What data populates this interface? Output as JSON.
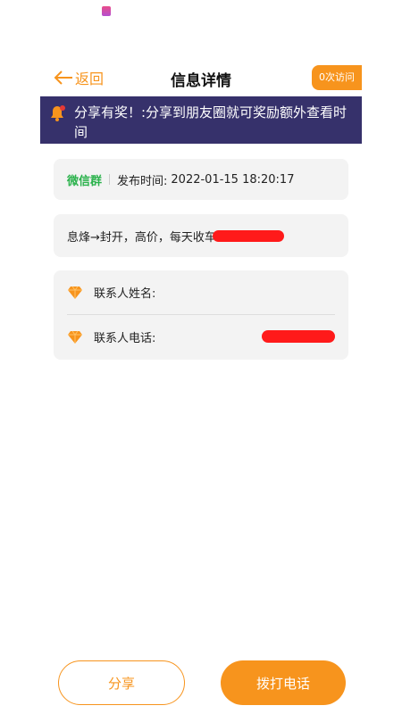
{
  "header": {
    "back_label": "返回",
    "title": "信息详情",
    "visits": "0次访问"
  },
  "banner": {
    "text": "分享有奖！:分享到朋友圈就可奖励额外查看时间"
  },
  "post": {
    "source_tag": "微信群",
    "publish_label": "发布时间:",
    "publish_time": "2022-01-15 18:20:17",
    "content": "息烽→封开，高价，每天收车"
  },
  "contact": {
    "name_label": "联系人姓名:",
    "phone_label": "联系人电话:"
  },
  "actions": {
    "share_label": "分享",
    "call_label": "拨打电话"
  },
  "colors": {
    "accent": "#f7941d",
    "banner_bg": "#36316b",
    "tag_green": "#2bb24c",
    "card_bg": "#f3f3f3"
  }
}
